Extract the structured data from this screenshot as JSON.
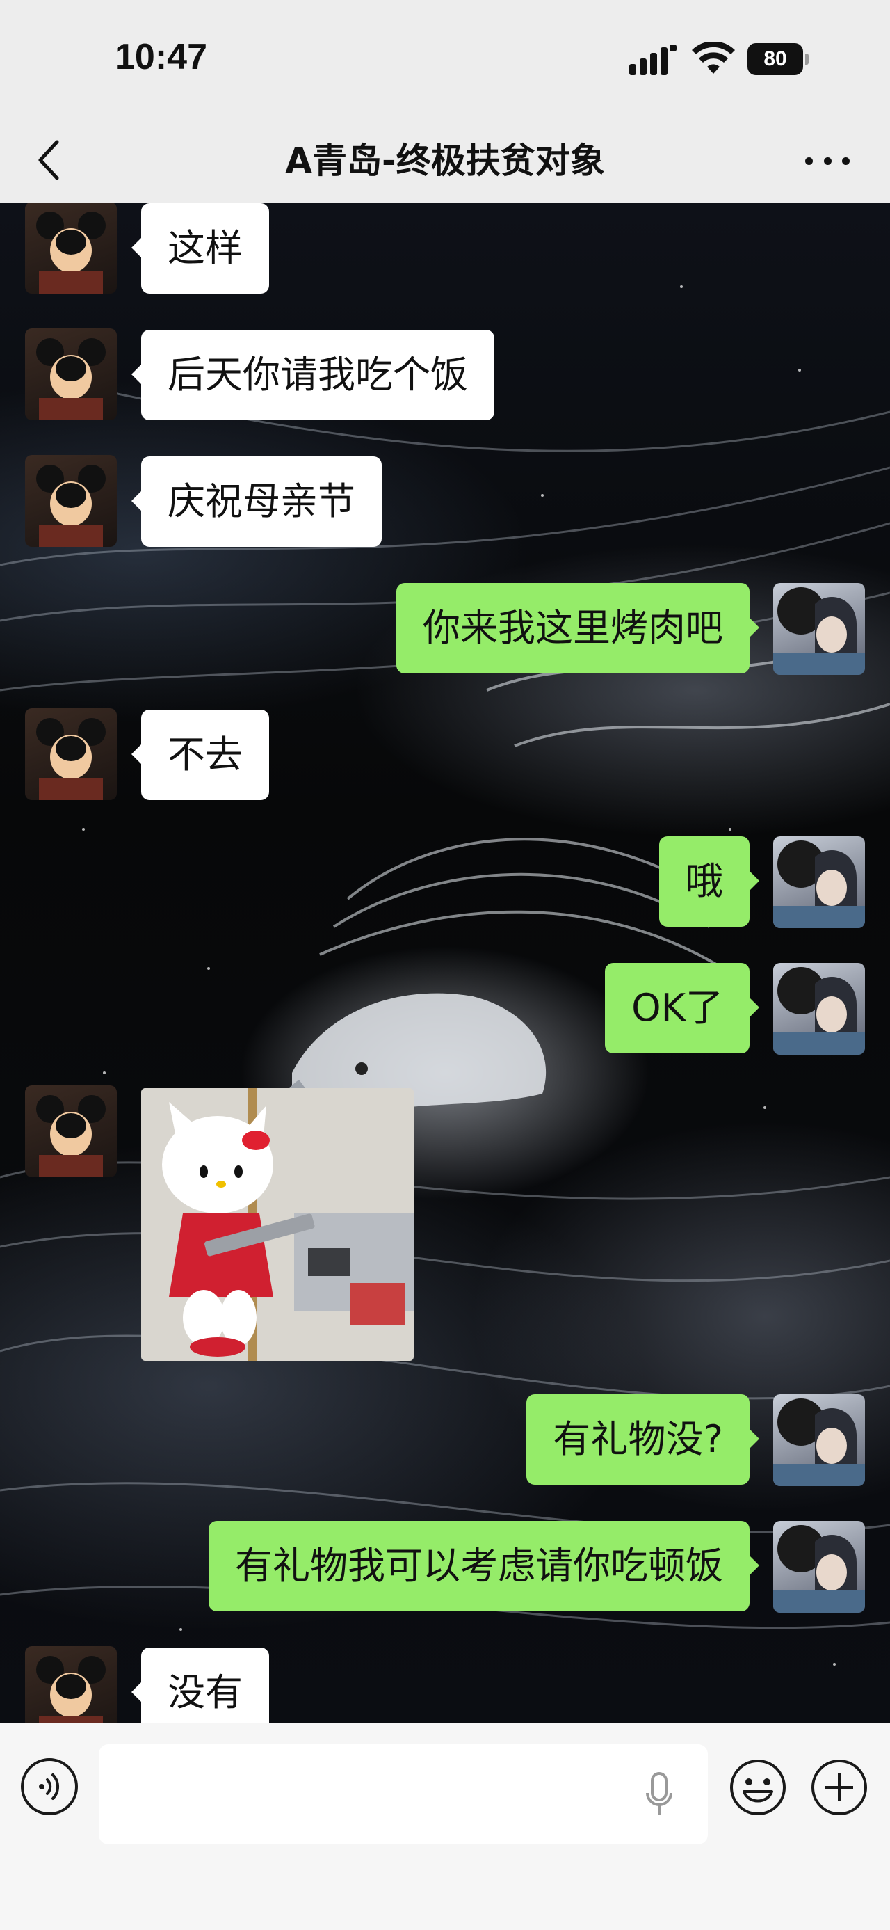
{
  "status_bar": {
    "time": "10:47",
    "battery": "80"
  },
  "nav": {
    "title": "A青岛-终极扶贫对象"
  },
  "messages": [
    {
      "side": "left",
      "text": "这样"
    },
    {
      "side": "left",
      "text": "后天你请我吃个饭"
    },
    {
      "side": "left",
      "text": "庆祝母亲节"
    },
    {
      "side": "right",
      "text": "你来我这里烤肉吧"
    },
    {
      "side": "left",
      "text": "不去"
    },
    {
      "side": "right",
      "text": "哦"
    },
    {
      "side": "right",
      "text": "OK了"
    },
    {
      "side": "left",
      "type": "image",
      "icon": "hello-kitty-photo"
    },
    {
      "side": "right",
      "text": "有礼物没?"
    },
    {
      "side": "right",
      "text": "有礼物我可以考虑请你吃顿饭"
    },
    {
      "side": "left",
      "text": "没有"
    }
  ],
  "input_bar": {
    "placeholder": "",
    "icons": [
      "voice-icon",
      "mic-icon",
      "emoji-icon",
      "plus-icon"
    ]
  },
  "colors": {
    "bubble_left": "#ffffff",
    "bubble_right": "#95ec69",
    "chrome_background": "#ededed"
  }
}
